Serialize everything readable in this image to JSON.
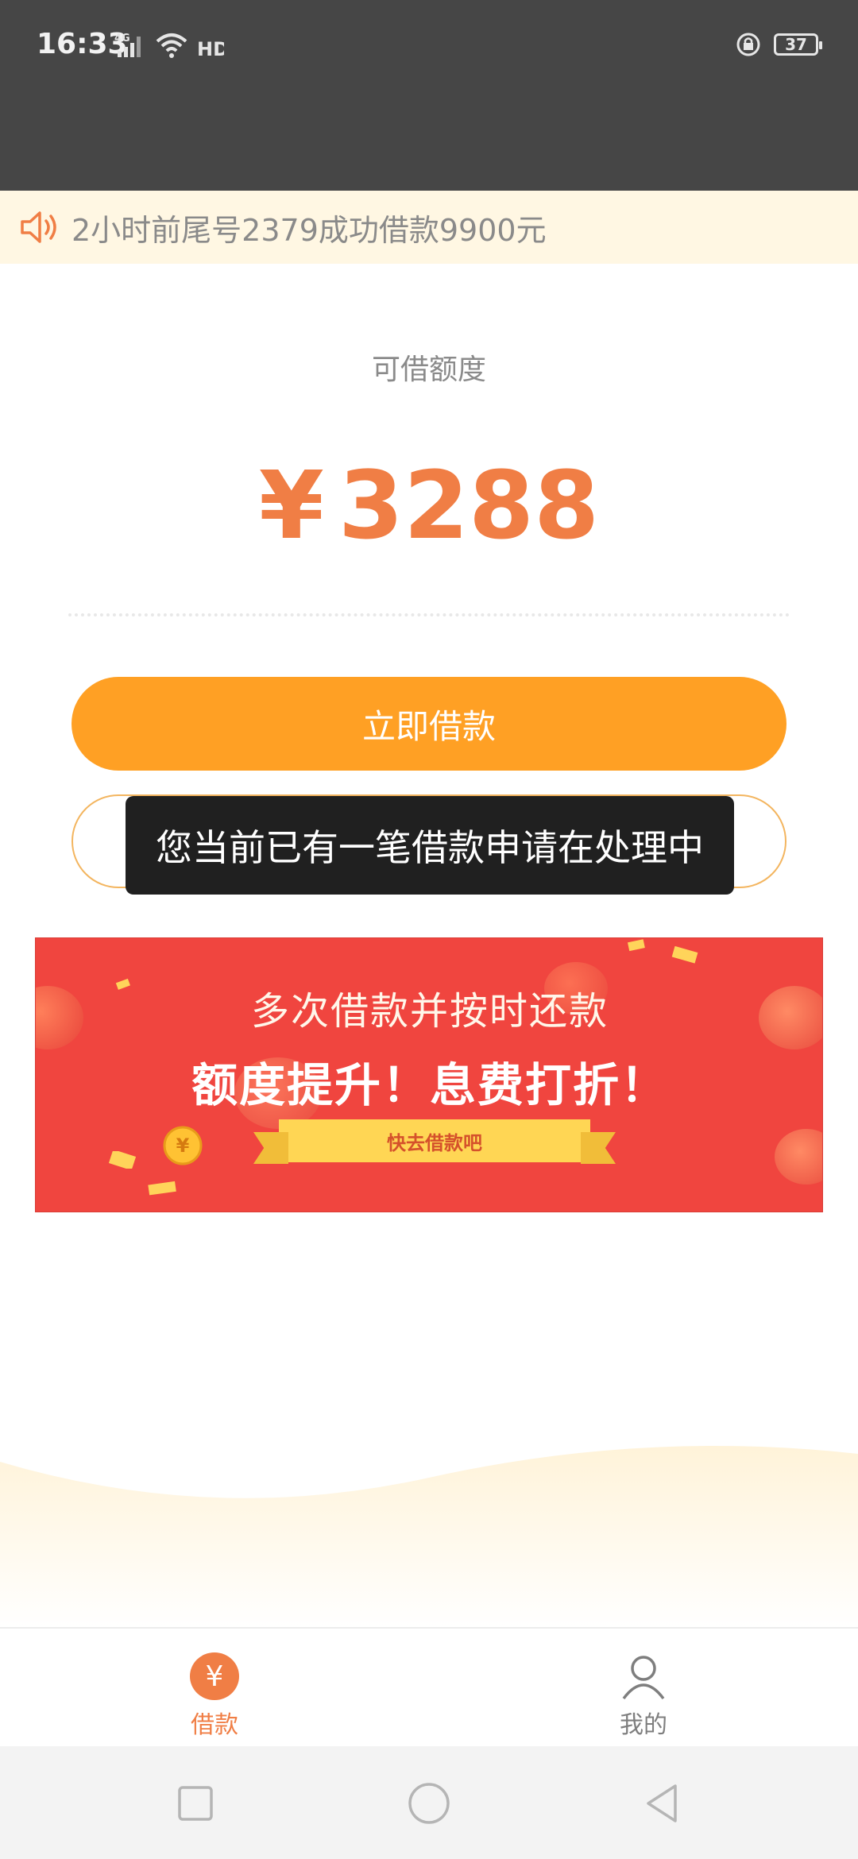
{
  "status_bar": {
    "time": "16:33",
    "network": "4G",
    "hd": "HD",
    "battery": "37"
  },
  "notice": {
    "text": "2小时前尾号2379成功借款9900元",
    "icon": "speaker-icon"
  },
  "credit": {
    "label": "可借额度",
    "currency": "¥",
    "amount": "3288"
  },
  "actions": {
    "borrow_now": "立即借款"
  },
  "toast": {
    "message": "您当前已有一笔借款申请在处理中"
  },
  "banner": {
    "line1": "多次借款并按时还款",
    "line2": "额度提升！息费打折！",
    "ribbon": "快去借款吧"
  },
  "tabs": [
    {
      "label": "借款",
      "icon": "yen-icon",
      "active": true
    },
    {
      "label": "我的",
      "icon": "person-icon",
      "active": false
    }
  ],
  "nav": [
    "square-icon",
    "circle-icon",
    "back-triangle-icon"
  ],
  "colors": {
    "accent": "#f07e45",
    "button": "#ffa024",
    "banner": "#f0453f",
    "status_bar": "#464646"
  }
}
